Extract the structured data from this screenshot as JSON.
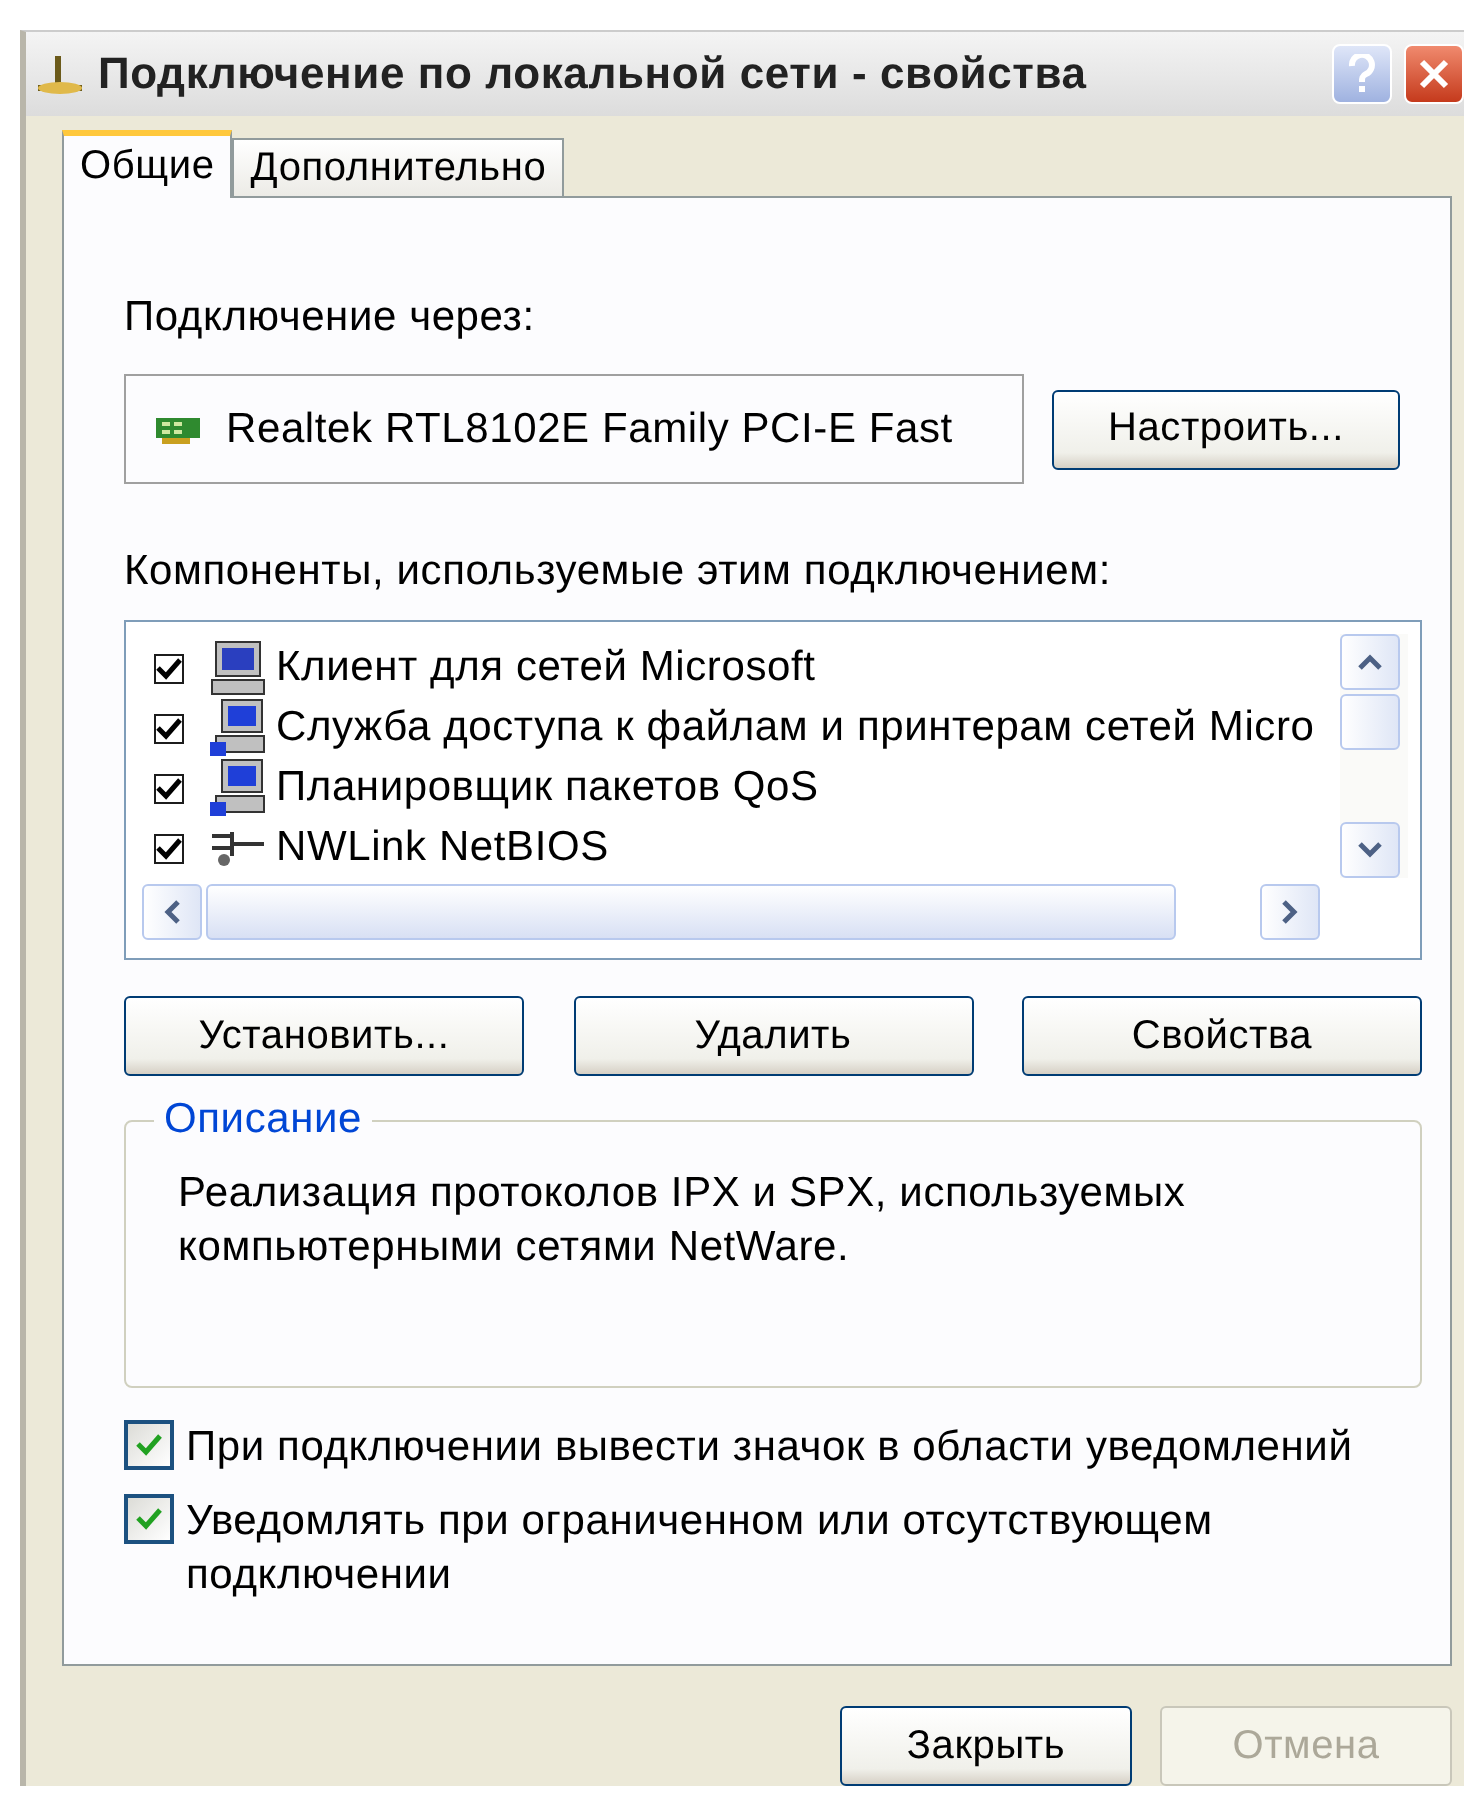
{
  "window": {
    "title": "Подключение по локальной сети - свойства"
  },
  "tabs": [
    {
      "label": "Общие",
      "selected": true
    },
    {
      "label": "Дополнительно",
      "selected": false
    }
  ],
  "connect_via": {
    "label": "Подключение через:",
    "adapter": "Realtek RTL8102E Family PCI-E Fast",
    "button": "Настроить..."
  },
  "components": {
    "label": "Компоненты, используемые этим подключением:",
    "items": [
      {
        "kind": "client",
        "label": "Клиент для сетей Microsoft",
        "checked": true
      },
      {
        "kind": "service",
        "label": "Служба доступа к файлам и принтерам сетей Micro",
        "checked": true
      },
      {
        "kind": "service",
        "label": "Планировщик пакетов QoS",
        "checked": true
      },
      {
        "kind": "protocol",
        "label": "NWLink NetBIOS",
        "checked": true
      }
    ]
  },
  "component_buttons": [
    {
      "label": "Установить...",
      "disabled": false
    },
    {
      "label": "Удалить",
      "disabled": false
    },
    {
      "label": "Свойства",
      "disabled": false
    }
  ],
  "description": {
    "legend": "Описание",
    "text": "Реализация протоколов IPX и SPX, используемых компьютерными сетями NetWare."
  },
  "options": [
    {
      "label": "При подключении вывести значок в области уведомлений",
      "checked": true
    },
    {
      "label": "Уведомлять при ограниченном или отсутствующем подключении",
      "checked": true
    }
  ],
  "footer_buttons": [
    {
      "label": "Закрыть",
      "disabled": false
    },
    {
      "label": "Отмена",
      "disabled": true
    }
  ]
}
